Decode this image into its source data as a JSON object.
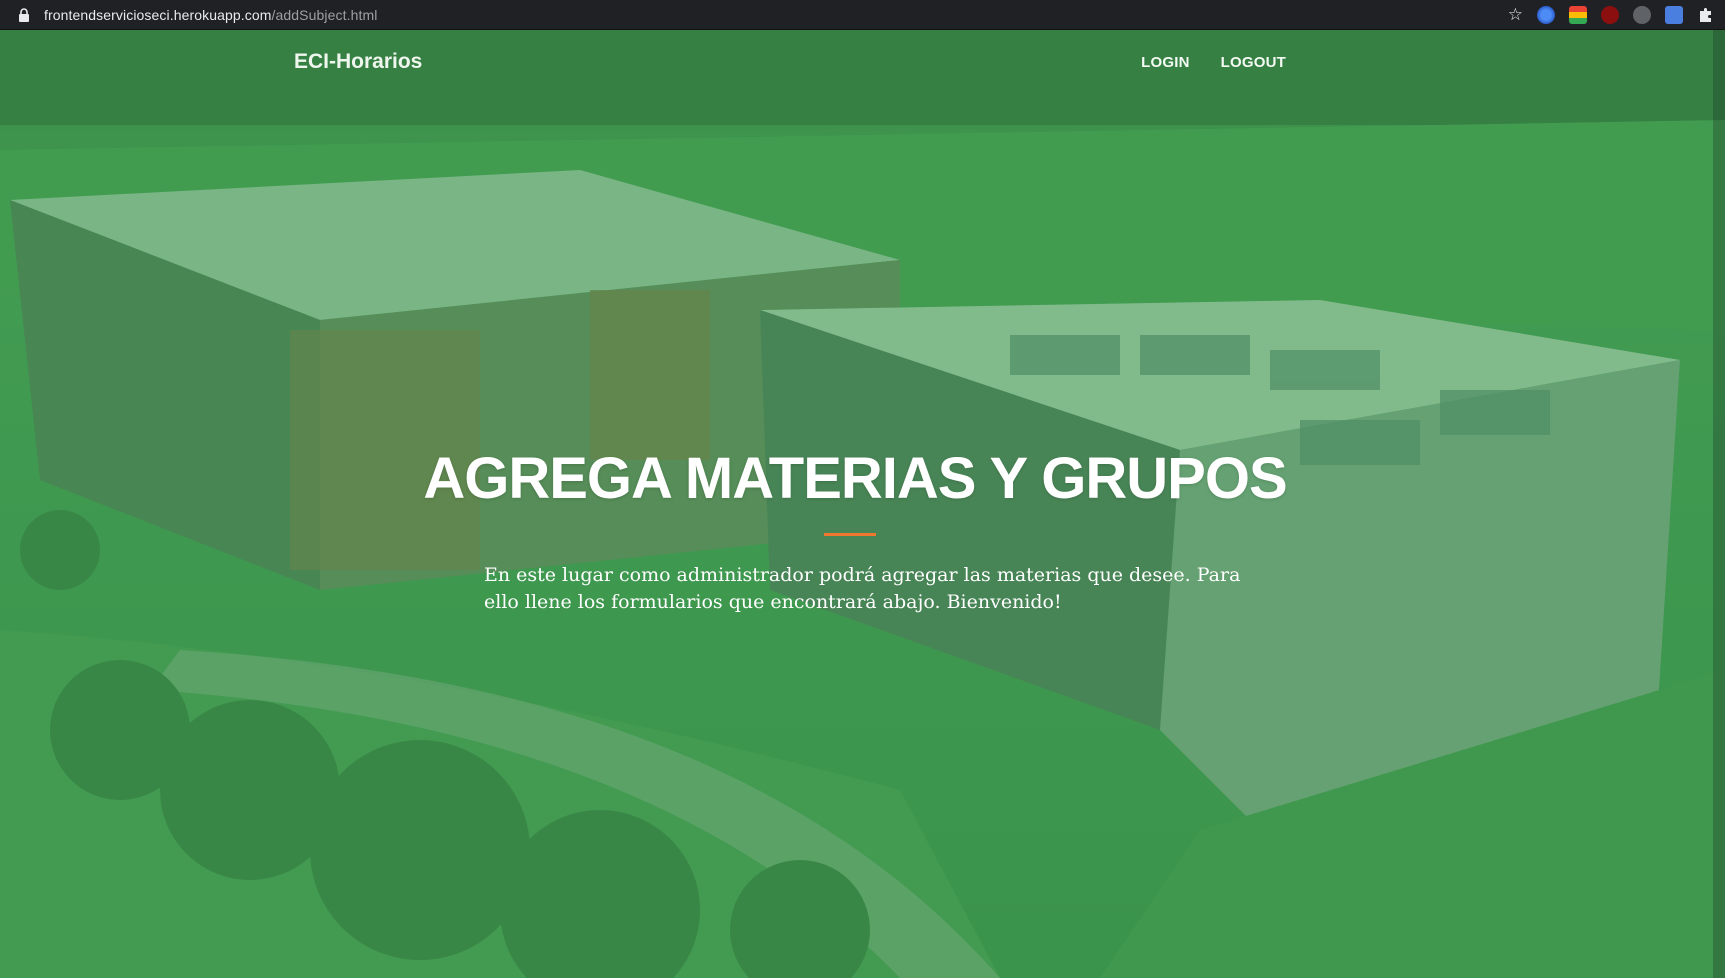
{
  "browser": {
    "url_host": "frontendservicioseci.herokuapp.com",
    "url_path": "/addSubject.html",
    "icons": [
      "lock-icon",
      "bookmark-star-icon",
      "extension-icons"
    ]
  },
  "navbar": {
    "brand": "ECI-Horarios",
    "links": [
      "LOGIN",
      "LOGOUT"
    ]
  },
  "hero": {
    "title": "AGREGA MATERIAS Y GRUPOS",
    "lead": "En este lugar como administrador podrá agregar las materias que desee. Para ello llene los formularios que encontrará abajo. Bienvenido!",
    "accent_color": "#f0772e",
    "overlay_color": "#46aa5a"
  }
}
